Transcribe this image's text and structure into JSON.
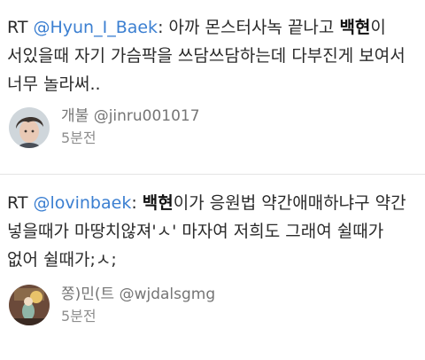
{
  "tweets": [
    {
      "rt_prefix": "RT ",
      "mention": "@Hyun_I_Baek",
      "text_parts": [
        ": 아까 몬스터사녹 끝나고 ",
        "백현",
        "이 서있을때 자기 가슴팍을 쓰담쓰담하는데 다부진게 보여서 너무 놀라써.."
      ],
      "display_name": "개불",
      "handle": "@jinru001017",
      "time": "5분전",
      "avatar_colors": {
        "bg": "#cfd6db",
        "hair": "#3d3530",
        "face": "#e9c9b5"
      }
    },
    {
      "rt_prefix": "RT ",
      "mention": "@lovinbaek",
      "text_parts": [
        ": ",
        "백현",
        "이가 응원법 약간애매하냐구 약간 넣을때가 마땅치않져'ㅅ' 마자여 저희도 그래여 쉴때가 없어 쉴때가;ㅅ;"
      ],
      "display_name": "쫑)민(트",
      "handle": "@wjdalsgmg",
      "time": "5분전",
      "avatar_colors": {
        "bg": "#6b4a3a",
        "light": "#e8c36a",
        "figure": "#8fb6a8"
      }
    }
  ],
  "colors": {
    "mention": "#3b7fd1",
    "text": "#2a2a2a",
    "meta": "#757575",
    "divider": "#e4e4e4"
  }
}
